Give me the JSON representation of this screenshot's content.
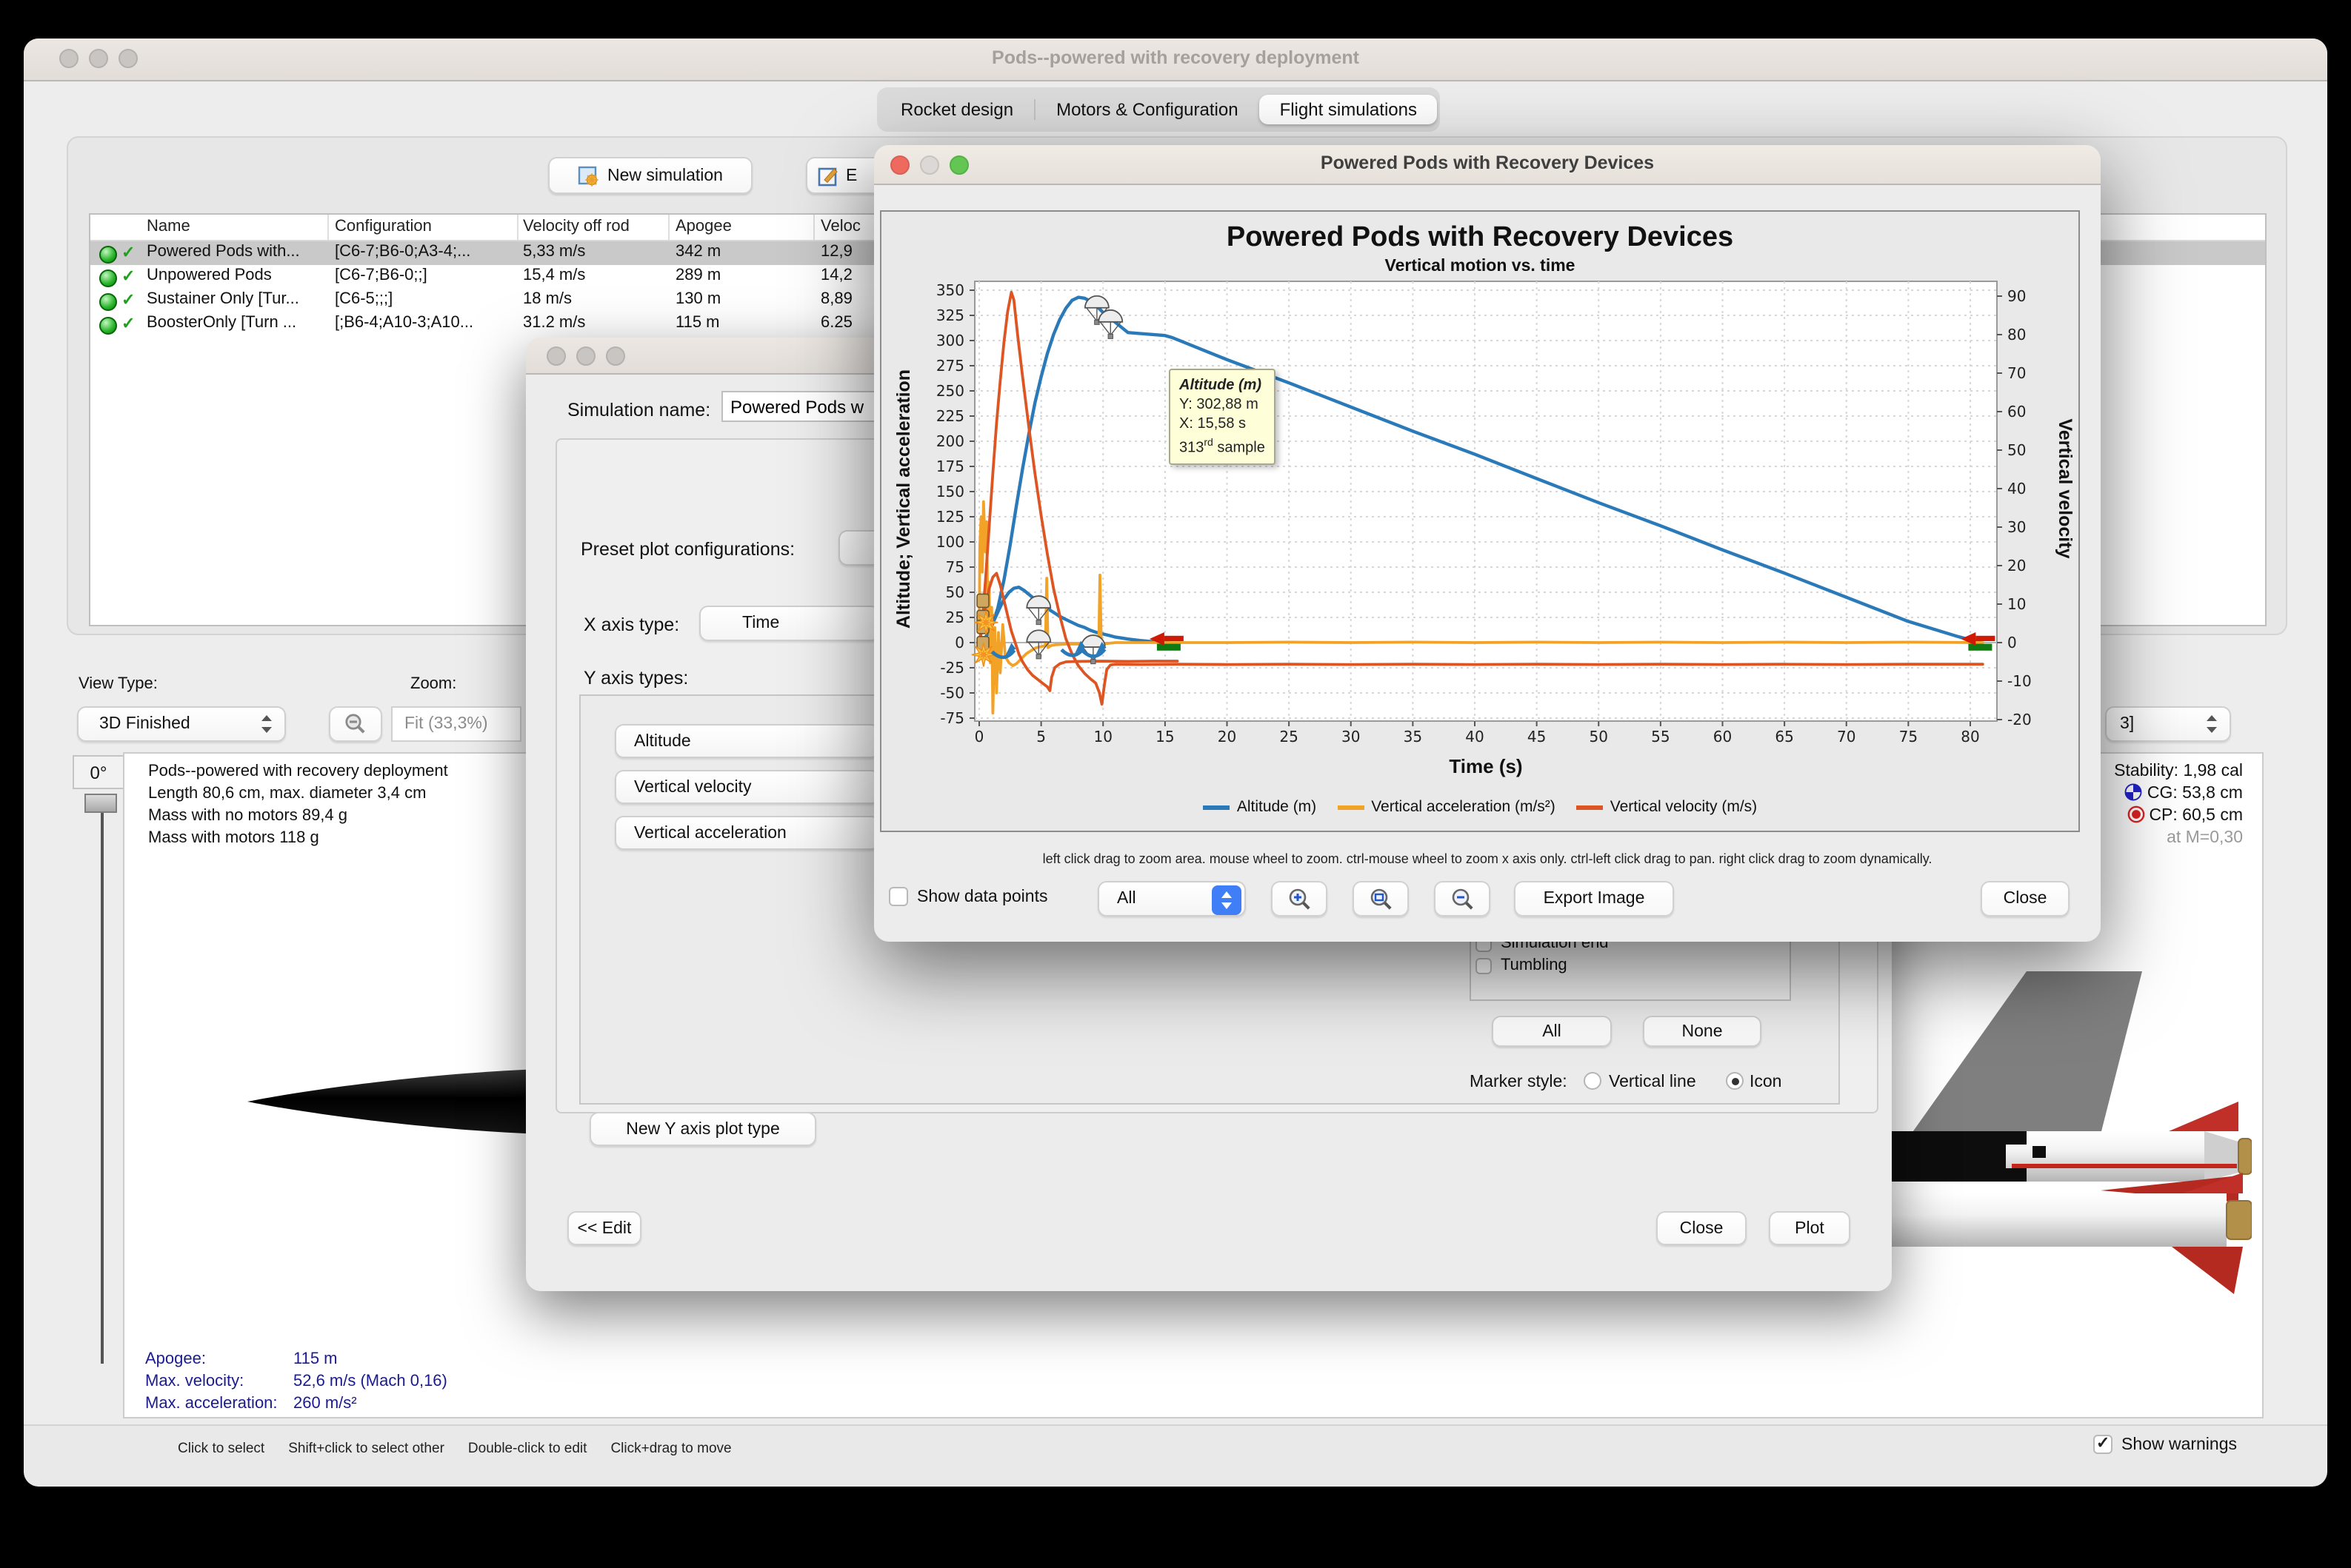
{
  "win": {
    "title": "Pods--powered with recovery deployment"
  },
  "tabs": [
    {
      "label": "Rocket design"
    },
    {
      "label": "Motors & Configuration"
    },
    {
      "label": "Flight simulations"
    }
  ],
  "toolbar": {
    "new_simulation": "New simulation",
    "edit_partial": "E"
  },
  "table": {
    "columns": [
      "Name",
      "Configuration",
      "Velocity off rod",
      "Apogee",
      "Veloc"
    ],
    "rows": [
      {
        "name": "Powered Pods with...",
        "config": "[C6-7;B6-0;A3-4;...",
        "vrod": "5,33 m/s",
        "apogee": "342 m",
        "vdep": "12,9",
        "selected": true
      },
      {
        "name": "Unpowered Pods",
        "config": "[C6-7;B6-0;;]",
        "vrod": "15,4 m/s",
        "apogee": "289 m",
        "vdep": "14,2",
        "selected": false
      },
      {
        "name": "Sustainer Only [Tur...",
        "config": "[C6-5;;;]",
        "vrod": "18 m/s",
        "apogee": "130 m",
        "vdep": "8,89",
        "selected": false
      },
      {
        "name": "BoosterOnly [Turn ...",
        "config": "[;B6-4;A10-3;A10...",
        "vrod": "31.2 m/s",
        "apogee": "115 m",
        "vdep": "6.25",
        "selected": false
      }
    ]
  },
  "view": {
    "view_type_label": "View Type:",
    "view_type_value": "3D Finished",
    "zoom_label": "Zoom:",
    "zoom_value": "Fit (33,3%)",
    "angle": "0°"
  },
  "rocket_info": [
    "Pods--powered with recovery deployment",
    "Length 80,6 cm, max. diameter 3,4 cm",
    "Mass with no motors 89,4 g",
    "Mass with motors 118 g"
  ],
  "metrics": {
    "apogee_label": "Apogee:",
    "apogee": "115 m",
    "maxv_label": "Max. velocity:",
    "maxv": "52,6 m/s  (Mach 0,16)",
    "maxa_label": "Max. acceleration:",
    "maxa": "260 m/s²"
  },
  "stability": {
    "combo": "3]",
    "stability": "Stability: 1,98 cal",
    "cg": "CG: 53,8 cm",
    "cp": "CP: 60,5 cm",
    "at_mach": "at M=0,30"
  },
  "status": {
    "hints": [
      "Click to select",
      "Shift+click to select other",
      "Double-click to edit",
      "Click+drag to move"
    ],
    "show_warnings": "Show warnings"
  },
  "dialog": {
    "sim_name_label": "Simulation name:",
    "sim_name_value": "Powered Pods w",
    "preset_label": "Preset plot configurations:",
    "x_axis_label": "X axis type:",
    "x_axis_value": "Time",
    "y_axis_label": "Y axis types:",
    "y_types": [
      "Altitude",
      "Vertical velocity",
      "Vertical acceleration"
    ],
    "events": [
      "Simulation end",
      "Tumbling"
    ],
    "all_btn": "All",
    "none_btn": "None",
    "marker_label": "Marker style:",
    "marker_options": [
      "Vertical line",
      "Icon"
    ],
    "new_y_btn": "New Y axis plot type",
    "edit_btn": "<< Edit",
    "close_btn": "Close",
    "plot_btn": "Plot"
  },
  "plot": {
    "title": "Powered Pods with Recovery Devices",
    "hint": "left click drag to zoom area. mouse wheel to zoom. ctrl-mouse wheel to zoom x axis only. ctrl-left click drag to pan.  right click drag to zoom dynamically.",
    "show_points": "Show data points",
    "branch_value": "All",
    "export_btn": "Export Image",
    "close_btn": "Close",
    "tooltip": {
      "title": "Altitude (m)",
      "y": "Y: 302,88 m",
      "x": "X: 15,58 s",
      "sample_num": "313",
      "sample_ord": "rd",
      "sample_rest": " sample"
    }
  },
  "chart_data": {
    "type": "line",
    "title": "Powered Pods with Recovery Devices",
    "subtitle": "Vertical motion vs. time",
    "xlabel": "Time (s)",
    "ylabel_left": "Altitude; Vertical acceleration",
    "ylabel_right": "Vertical velocity",
    "x_range": [
      0,
      82.5
    ],
    "left_range": [
      -75,
      350
    ],
    "right_range": [
      -20,
      90
    ],
    "x_ticks": [
      0,
      5,
      10,
      15,
      20,
      25,
      30,
      35,
      40,
      45,
      50,
      55,
      60,
      65,
      70,
      75,
      80
    ],
    "left_ticks": [
      350,
      325,
      300,
      275,
      250,
      225,
      200,
      175,
      150,
      125,
      100,
      75,
      50,
      25,
      0,
      -25,
      -50,
      -75
    ],
    "right_ticks": [
      90,
      80,
      70,
      60,
      50,
      40,
      30,
      20,
      10,
      0,
      -10,
      -20
    ],
    "grid": true,
    "legend_position": "bottom",
    "legend": [
      {
        "label": "Altitude (m)",
        "color": "#2a7ab9"
      },
      {
        "label": "Vertical acceleration (m/s²)",
        "color": "#f2a227"
      },
      {
        "label": "Vertical velocity (m/s)",
        "color": "#dd5522"
      }
    ],
    "series": [
      {
        "name": "Altitude (m)",
        "axis": "left",
        "color": "#2a7ab9",
        "width": 2.2,
        "points": [
          [
            0,
            0
          ],
          [
            0.5,
            5
          ],
          [
            1,
            16
          ],
          [
            1.5,
            34
          ],
          [
            2,
            62
          ],
          [
            2.5,
            97
          ],
          [
            3,
            136
          ],
          [
            3.5,
            173
          ],
          [
            4,
            207
          ],
          [
            4.5,
            238
          ],
          [
            5,
            264
          ],
          [
            5.5,
            287
          ],
          [
            6,
            306
          ],
          [
            6.5,
            321
          ],
          [
            7,
            332
          ],
          [
            7.5,
            340
          ],
          [
            8,
            343
          ],
          [
            8.5,
            342
          ],
          [
            9,
            339
          ],
          [
            9.5,
            334
          ],
          [
            10,
            328
          ],
          [
            11,
            318
          ],
          [
            12,
            308
          ],
          [
            15,
            305
          ],
          [
            15.58,
            302.88
          ],
          [
            20,
            281
          ],
          [
            25,
            258
          ],
          [
            30,
            234
          ],
          [
            35,
            210
          ],
          [
            40,
            187
          ],
          [
            45,
            163
          ],
          [
            50,
            139
          ],
          [
            55,
            116
          ],
          [
            60,
            92
          ],
          [
            65,
            69
          ],
          [
            70,
            45
          ],
          [
            75,
            21
          ],
          [
            79,
            6
          ],
          [
            80.8,
            0
          ]
        ]
      },
      {
        "name": "Altitude pods branch (m)",
        "axis": "left",
        "color": "#2a7ab9",
        "width": 2.2,
        "in_legend": false,
        "points": [
          [
            0,
            0
          ],
          [
            0.4,
            3
          ],
          [
            0.8,
            11
          ],
          [
            1.2,
            22
          ],
          [
            1.6,
            33
          ],
          [
            2,
            43
          ],
          [
            2.4,
            50
          ],
          [
            2.8,
            54
          ],
          [
            3.2,
            55
          ],
          [
            3.6,
            52
          ],
          [
            4,
            48
          ],
          [
            4.5,
            43
          ],
          [
            5,
            38
          ],
          [
            5.5,
            34
          ],
          [
            6,
            30
          ],
          [
            6.5,
            26
          ],
          [
            7,
            23
          ],
          [
            7.5,
            20
          ],
          [
            8,
            17
          ],
          [
            8.5,
            15
          ],
          [
            9,
            12
          ],
          [
            9.5,
            10
          ],
          [
            10,
            8.5
          ],
          [
            10.5,
            7
          ],
          [
            11,
            5.5
          ],
          [
            11.5,
            4.5
          ],
          [
            12,
            3.5
          ],
          [
            12.5,
            2.8
          ],
          [
            13,
            2
          ],
          [
            13.5,
            1.4
          ],
          [
            14,
            0.9
          ],
          [
            14.5,
            0.4
          ],
          [
            15,
            0.1
          ],
          [
            15.3,
            0
          ]
        ]
      },
      {
        "name": "Vertical acceleration (m/s²)",
        "axis": "left",
        "color": "#f2a227",
        "width": 1.9,
        "points": [
          [
            0,
            10
          ],
          [
            0.05,
            95
          ],
          [
            0.15,
            125
          ],
          [
            0.25,
            70
          ],
          [
            0.35,
            140
          ],
          [
            0.5,
            90
          ],
          [
            0.6,
            120
          ],
          [
            0.7,
            20
          ],
          [
            0.8,
            60
          ],
          [
            0.9,
            -20
          ],
          [
            1.0,
            35
          ],
          [
            1.1,
            -70
          ],
          [
            1.25,
            15
          ],
          [
            1.4,
            -50
          ],
          [
            1.55,
            10
          ],
          [
            1.7,
            -30
          ],
          [
            1.9,
            18
          ],
          [
            2.1,
            -14
          ],
          [
            2.4,
            -20
          ],
          [
            2.7,
            -23
          ],
          [
            3,
            -21
          ],
          [
            3.4,
            -16
          ],
          [
            3.8,
            -11
          ],
          [
            4.2,
            -8
          ],
          [
            4.6,
            -5
          ],
          [
            5,
            -4
          ],
          [
            5.35,
            -3
          ],
          [
            5.45,
            64
          ],
          [
            5.55,
            -5
          ],
          [
            5.8,
            -3
          ],
          [
            6.2,
            -2
          ],
          [
            7,
            -1.5
          ],
          [
            8,
            -1.5
          ],
          [
            9,
            -1.5
          ],
          [
            9.65,
            -2
          ],
          [
            9.75,
            67
          ],
          [
            9.85,
            -3
          ],
          [
            10.2,
            -1
          ],
          [
            11,
            0
          ],
          [
            15,
            0
          ],
          [
            20,
            0
          ],
          [
            25,
            0.5
          ],
          [
            30,
            0
          ],
          [
            35,
            0.5
          ],
          [
            40,
            0
          ],
          [
            45,
            0.5
          ],
          [
            50,
            0
          ],
          [
            55,
            0.5
          ],
          [
            60,
            0
          ],
          [
            65,
            0.5
          ],
          [
            70,
            0
          ],
          [
            75,
            0.5
          ],
          [
            81,
            0
          ]
        ]
      },
      {
        "name": "Vertical velocity (m/s)",
        "axis": "right",
        "color": "#dd5522",
        "width": 1.9,
        "points": [
          [
            0,
            0
          ],
          [
            0.2,
            4
          ],
          [
            0.5,
            16
          ],
          [
            0.8,
            30
          ],
          [
            1.1,
            44
          ],
          [
            1.4,
            57
          ],
          [
            1.7,
            68
          ],
          [
            2,
            78
          ],
          [
            2.3,
            86
          ],
          [
            2.6,
            91
          ],
          [
            2.8,
            89
          ],
          [
            3.1,
            80
          ],
          [
            3.5,
            69
          ],
          [
            4,
            56
          ],
          [
            4.5,
            44
          ],
          [
            5,
            33
          ],
          [
            5.5,
            23
          ],
          [
            6,
            14
          ],
          [
            6.5,
            7
          ],
          [
            7,
            1
          ],
          [
            7.5,
            -3
          ],
          [
            8,
            -6
          ],
          [
            8.5,
            -8
          ],
          [
            9,
            -9.5
          ],
          [
            9.4,
            -10.5
          ],
          [
            9.7,
            -13
          ],
          [
            9.9,
            -16
          ],
          [
            10.1,
            -11
          ],
          [
            10.3,
            -7
          ],
          [
            10.6,
            -5.8
          ],
          [
            11,
            -5.6
          ],
          [
            13,
            -5.7
          ],
          [
            16,
            -5.6
          ],
          [
            20,
            -5.7
          ],
          [
            25,
            -5.6
          ],
          [
            30,
            -5.7
          ],
          [
            35,
            -5.6
          ],
          [
            40,
            -5.7
          ],
          [
            45,
            -5.6
          ],
          [
            50,
            -5.7
          ],
          [
            55,
            -5.6
          ],
          [
            60,
            -5.7
          ],
          [
            65,
            -5.6
          ],
          [
            70,
            -5.7
          ],
          [
            75,
            -5.6
          ],
          [
            81,
            -5.6
          ]
        ]
      },
      {
        "name": "Vertical velocity pods branch (m/s)",
        "axis": "right",
        "color": "#dd5522",
        "width": 1.9,
        "in_legend": false,
        "points": [
          [
            0,
            0
          ],
          [
            0.2,
            3
          ],
          [
            0.5,
            9
          ],
          [
            0.8,
            14
          ],
          [
            1.1,
            17
          ],
          [
            1.4,
            18
          ],
          [
            1.7,
            15
          ],
          [
            2,
            11
          ],
          [
            2.3,
            7
          ],
          [
            2.6,
            3
          ],
          [
            2.9,
            0
          ],
          [
            3.2,
            -3
          ],
          [
            3.5,
            -5
          ],
          [
            3.9,
            -7
          ],
          [
            4.3,
            -8.5
          ],
          [
            4.7,
            -9.5
          ],
          [
            5.1,
            -10.5
          ],
          [
            5.5,
            -11.5
          ],
          [
            5.7,
            -12.5
          ],
          [
            5.85,
            -9
          ],
          [
            6.1,
            -6.5
          ],
          [
            6.5,
            -5.5
          ],
          [
            7,
            -5
          ],
          [
            8,
            -4.9
          ],
          [
            10,
            -4.8
          ],
          [
            12,
            -4.9
          ],
          [
            14,
            -4.8
          ],
          [
            16,
            -4.8
          ]
        ]
      }
    ],
    "markers": [
      {
        "type": "parachute",
        "t": 9.5,
        "v": 334,
        "axis": "left"
      },
      {
        "type": "parachute",
        "t": 10.6,
        "v": 320,
        "axis": "left"
      },
      {
        "type": "parachute",
        "t": 4.8,
        "v": 36,
        "axis": "left"
      },
      {
        "type": "parachute",
        "t": 4.8,
        "v": 2,
        "axis": "left"
      },
      {
        "type": "parachute",
        "t": 9.2,
        "v": -3,
        "axis": "left"
      },
      {
        "type": "motor",
        "t": 0.3,
        "v": 32,
        "axis": "left"
      },
      {
        "type": "motor",
        "t": 0.3,
        "v": 6,
        "axis": "left"
      },
      {
        "type": "burst",
        "t": 0.55,
        "v": 20,
        "axis": "left"
      },
      {
        "type": "burst",
        "t": 0.35,
        "v": -12,
        "axis": "left"
      },
      {
        "type": "arrow",
        "t": 2.0,
        "v": -12,
        "axis": "left"
      },
      {
        "type": "arrow",
        "t": 7.6,
        "v": -10,
        "axis": "left"
      },
      {
        "type": "arrow",
        "t": 9.3,
        "v": -11,
        "axis": "left"
      },
      {
        "type": "flag",
        "t": 15.3,
        "v": 0,
        "axis": "left"
      },
      {
        "type": "flag",
        "t": 80.8,
        "v": 0,
        "axis": "left"
      }
    ]
  }
}
